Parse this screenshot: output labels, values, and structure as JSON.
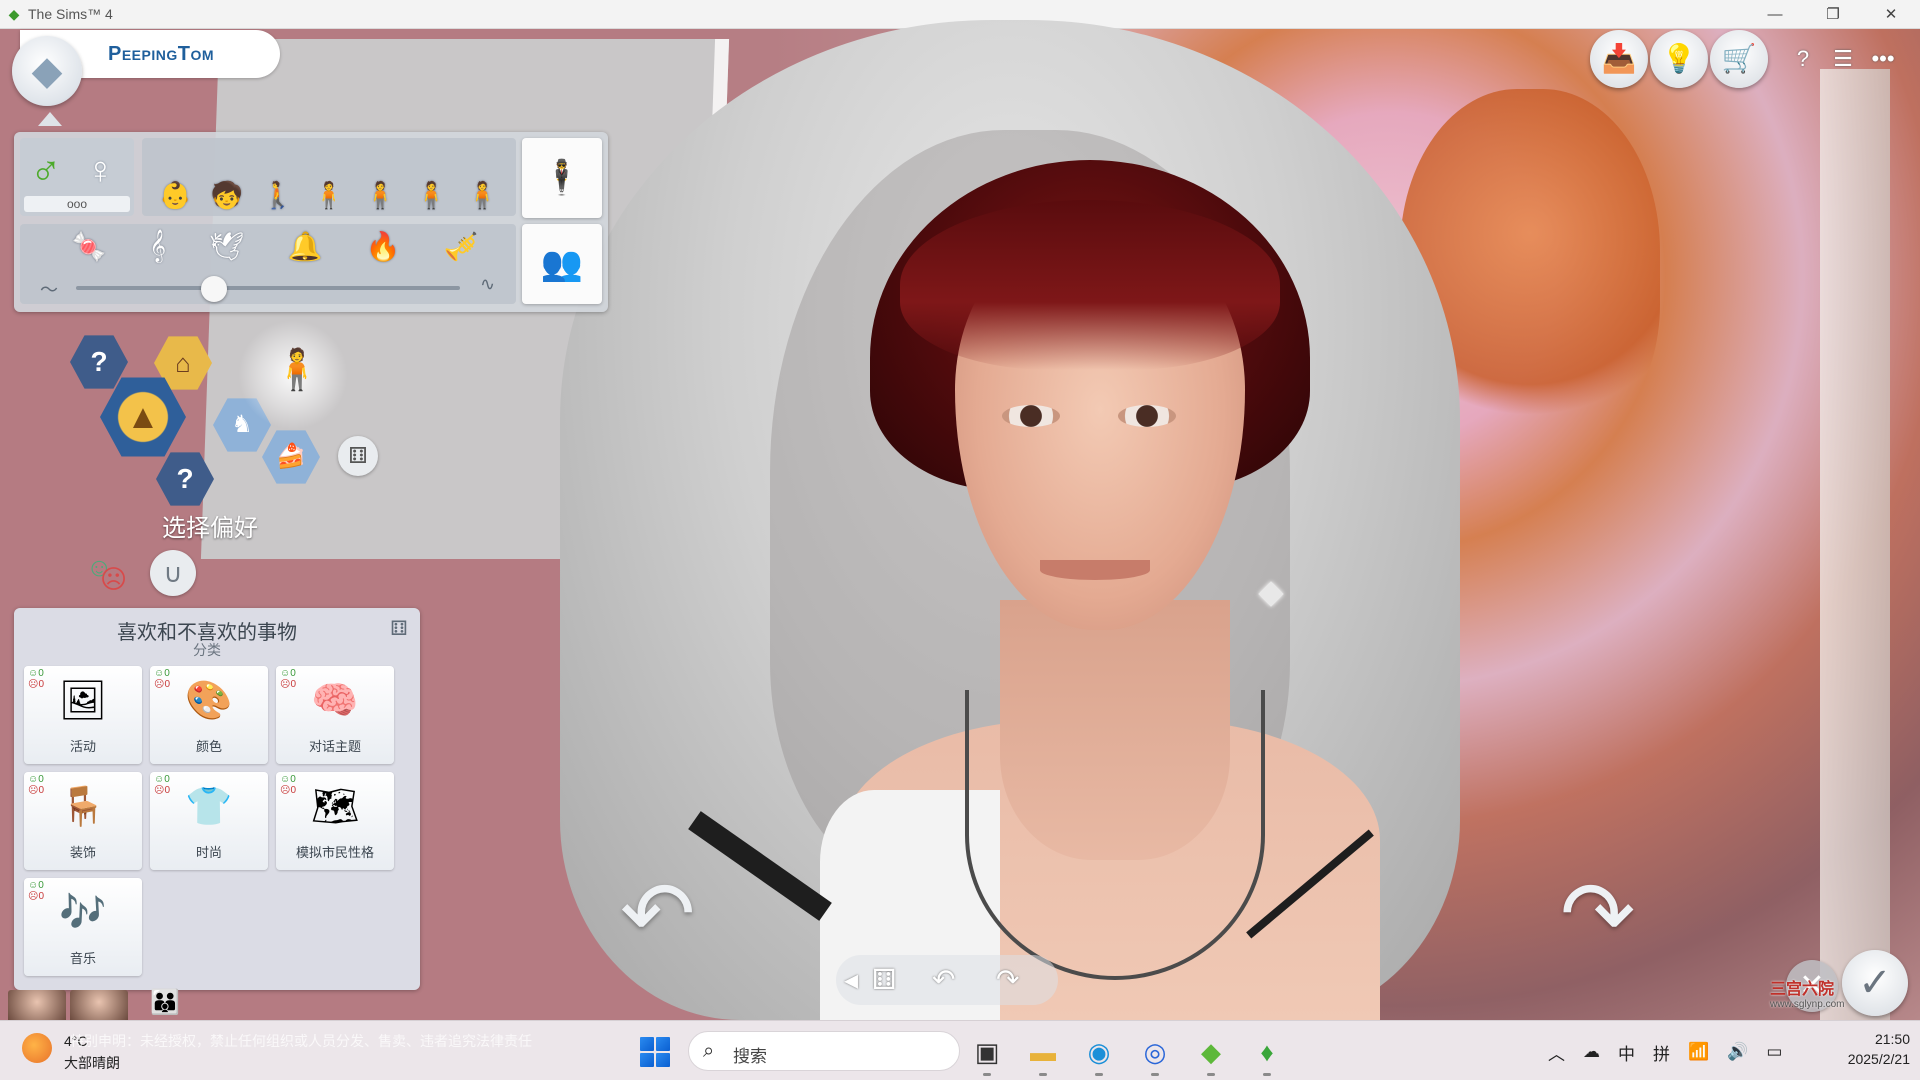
{
  "window": {
    "title": "The Sims™ 4",
    "minimize": "—",
    "restore": "❐",
    "close": "✕"
  },
  "sim": {
    "name": "PeepingTom"
  },
  "cas": {
    "gender": {
      "male_glyph": "♂",
      "female_glyph": "♀",
      "more": "ooo"
    },
    "ages": [
      "👶",
      "🧒",
      "🚶",
      "🧍",
      "🧍",
      "🧍",
      "🧍"
    ],
    "voices": [
      "🍬",
      "𝄞",
      "🕊",
      "🔔",
      "🔥",
      "🎺"
    ],
    "pitch": {
      "value": 0.36,
      "low_glyph": "〜",
      "high_glyph": "∿"
    },
    "preferences_label": "选择偏好"
  },
  "likes_panel": {
    "title": "喜欢和不喜欢的事物",
    "subtitle": "分类",
    "like_count": "0",
    "dislike_count": "0",
    "categories": [
      {
        "label": "活动",
        "icon": "🖼"
      },
      {
        "label": "颜色",
        "icon": "🎨"
      },
      {
        "label": "对话主题",
        "icon": "🧠"
      },
      {
        "label": "装饰",
        "icon": "🪑"
      },
      {
        "label": "时尚",
        "icon": "👕"
      },
      {
        "label": "模拟市民性格",
        "icon": "🗺"
      },
      {
        "label": "音乐",
        "icon": "🎶"
      }
    ]
  },
  "taskbar": {
    "weather_temp": "4°C",
    "weather_cond": "大部晴朗",
    "marquee": "特别申明：未经授权，禁止任何组织或人员分发、售卖、违者追究法律责任",
    "search_placeholder": "搜索",
    "tray_ime_cn": "中",
    "tray_ime_pin": "拼",
    "time": "21:50",
    "date": "2025/2/21"
  },
  "watermark": {
    "name": "三宫六院",
    "url": "www.sglynp.com"
  }
}
